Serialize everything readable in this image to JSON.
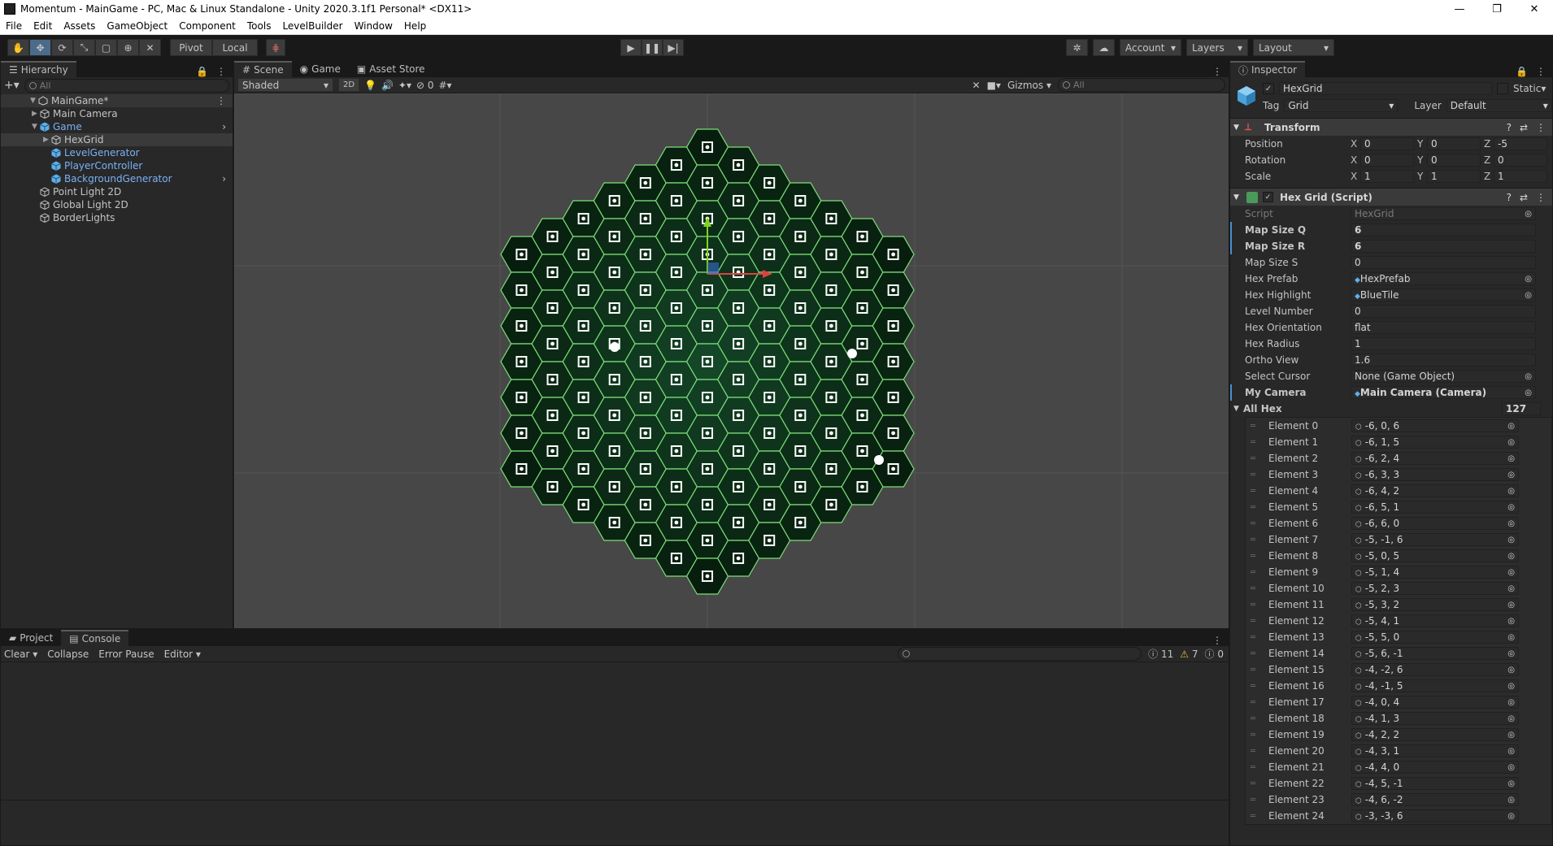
{
  "window": {
    "title": "Momentum - MainGame - PC, Mac & Linux Standalone - Unity 2020.3.1f1 Personal* <DX11>",
    "controls": [
      "—",
      "❐",
      "✕"
    ]
  },
  "menu": [
    "File",
    "Edit",
    "Assets",
    "GameObject",
    "Component",
    "Tools",
    "LevelBuilder",
    "Window",
    "Help"
  ],
  "toolbar": {
    "pivot": "Pivot",
    "local": "Local",
    "account": "Account",
    "layers": "Layers",
    "layout": "Layout"
  },
  "hierarchy": {
    "tab": "Hierarchy",
    "search_placeholder": "All",
    "items": [
      {
        "name": "MainGame*",
        "depth": 0,
        "blue": false,
        "expanded": true
      },
      {
        "name": "Main Camera",
        "depth": 1,
        "blue": false
      },
      {
        "name": "Game",
        "depth": 1,
        "blue": true,
        "expanded": true
      },
      {
        "name": "HexGrid",
        "depth": 2,
        "blue": false,
        "selected": true
      },
      {
        "name": "LevelGenerator",
        "depth": 2,
        "blue": true
      },
      {
        "name": "PlayerController",
        "depth": 2,
        "blue": true
      },
      {
        "name": "BackgroundGenerator",
        "depth": 2,
        "blue": true
      },
      {
        "name": "Point Light 2D",
        "depth": 1,
        "blue": false
      },
      {
        "name": "Global Light 2D",
        "depth": 1,
        "blue": false
      },
      {
        "name": "BorderLights",
        "depth": 1,
        "blue": false
      }
    ]
  },
  "scene": {
    "tabs": [
      "Scene",
      "Game",
      "Asset Store"
    ],
    "shading": "Shaded",
    "mode2d": "2D",
    "hidden_count": "0",
    "gizmos": "Gizmos",
    "search_placeholder": "All"
  },
  "console": {
    "tabs": [
      "Project",
      "Console"
    ],
    "clear": "Clear",
    "collapse": "Collapse",
    "error_pause": "Error Pause",
    "editor": "Editor",
    "log_count": "11",
    "warn_count": "7",
    "error_count": "0"
  },
  "inspector": {
    "tab": "Inspector",
    "object_name": "HexGrid",
    "static": "Static",
    "tag_label": "Tag",
    "tag": "Grid",
    "layer_label": "Layer",
    "layer": "Default",
    "transform": {
      "title": "Transform",
      "rows": [
        {
          "label": "Position",
          "x": "0",
          "y": "0",
          "z": "-5"
        },
        {
          "label": "Rotation",
          "x": "0",
          "y": "0",
          "z": "0"
        },
        {
          "label": "Scale",
          "x": "1",
          "y": "1",
          "z": "1"
        }
      ]
    },
    "script": {
      "title": "Hex Grid (Script)",
      "fields": [
        {
          "label": "Script",
          "value": "HexGrid",
          "dim": true,
          "ref": true
        },
        {
          "label": "Map Size Q",
          "value": "6",
          "bold": true
        },
        {
          "label": "Map Size R",
          "value": "6",
          "bold": true
        },
        {
          "label": "Map Size S",
          "value": "0"
        },
        {
          "label": "Hex Prefab",
          "value": "HexPrefab",
          "ref": true
        },
        {
          "label": "Hex Highlight",
          "value": "BlueTile",
          "ref": true
        },
        {
          "label": "Level Number",
          "value": "0"
        },
        {
          "label": "Hex Orientation",
          "value": "flat"
        },
        {
          "label": "Hex Radius",
          "value": "1"
        },
        {
          "label": "Ortho View",
          "value": "1.6"
        },
        {
          "label": "Select Cursor",
          "value": "None (Game Object)",
          "ref": true
        },
        {
          "label": "My Camera",
          "value": "Main Camera (Camera)",
          "bold": true,
          "ref": true
        }
      ]
    },
    "all_hex": {
      "label": "All Hex",
      "count": "127",
      "elements": [
        {
          "label": "Element 0",
          "value": "-6, 0, 6"
        },
        {
          "label": "Element 1",
          "value": "-6, 1, 5"
        },
        {
          "label": "Element 2",
          "value": "-6, 2, 4"
        },
        {
          "label": "Element 3",
          "value": "-6, 3, 3"
        },
        {
          "label": "Element 4",
          "value": "-6, 4, 2"
        },
        {
          "label": "Element 5",
          "value": "-6, 5, 1"
        },
        {
          "label": "Element 6",
          "value": "-6, 6, 0"
        },
        {
          "label": "Element 7",
          "value": "-5, -1, 6"
        },
        {
          "label": "Element 8",
          "value": "-5, 0, 5"
        },
        {
          "label": "Element 9",
          "value": "-5, 1, 4"
        },
        {
          "label": "Element 10",
          "value": "-5, 2, 3"
        },
        {
          "label": "Element 11",
          "value": "-5, 3, 2"
        },
        {
          "label": "Element 12",
          "value": "-5, 4, 1"
        },
        {
          "label": "Element 13",
          "value": "-5, 5, 0"
        },
        {
          "label": "Element 14",
          "value": "-5, 6, -1"
        },
        {
          "label": "Element 15",
          "value": "-4, -2, 6"
        },
        {
          "label": "Element 16",
          "value": "-4, -1, 5"
        },
        {
          "label": "Element 17",
          "value": "-4, 0, 4"
        },
        {
          "label": "Element 18",
          "value": "-4, 1, 3"
        },
        {
          "label": "Element 19",
          "value": "-4, 2, 2"
        },
        {
          "label": "Element 20",
          "value": "-4, 3, 1"
        },
        {
          "label": "Element 21",
          "value": "-4, 4, 0"
        },
        {
          "label": "Element 22",
          "value": "-4, 5, -1"
        },
        {
          "label": "Element 23",
          "value": "-4, 6, -2"
        },
        {
          "label": "Element 24",
          "value": "-3, -3, 6"
        }
      ]
    }
  }
}
